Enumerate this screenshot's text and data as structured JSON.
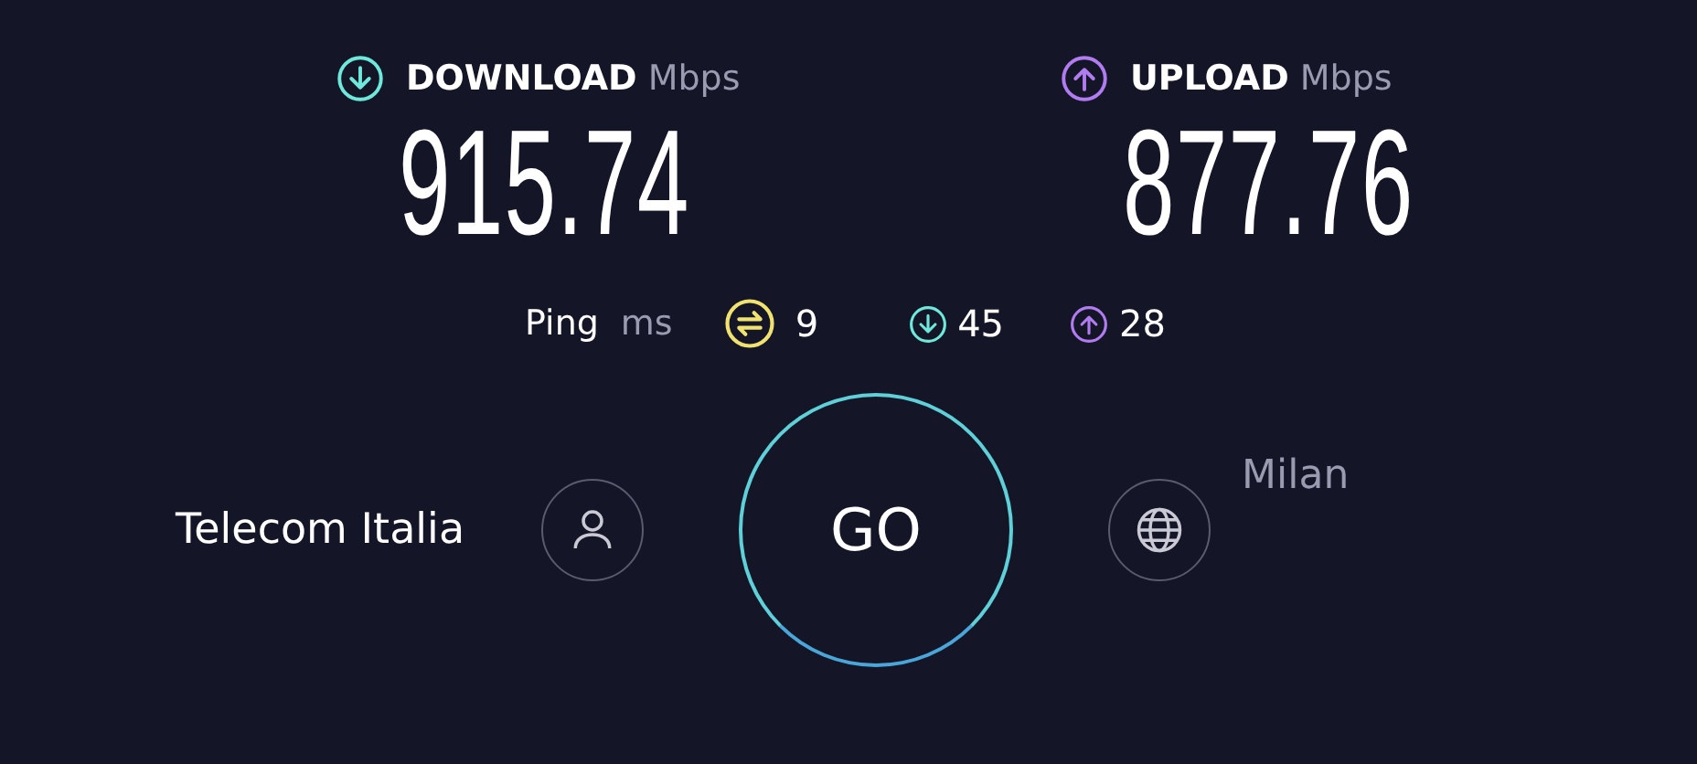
{
  "metrics": [
    {
      "kind": "download",
      "label": "DOWNLOAD",
      "unit": "Mbps",
      "value": "915.74",
      "color": "#6fe8dc"
    },
    {
      "kind": "upload",
      "label": "UPLOAD",
      "unit": "Mbps",
      "value": "877.76",
      "color": "#b07cf0"
    }
  ],
  "ping": {
    "label": "Ping",
    "unit": "ms",
    "items": [
      {
        "kind": "idle",
        "value": "9",
        "color": "#f0e270"
      },
      {
        "kind": "download",
        "value": "45",
        "color": "#6fe8dc"
      },
      {
        "kind": "upload",
        "value": "28",
        "color": "#b07cf0"
      }
    ]
  },
  "provider": {
    "name": "Telecom Italia"
  },
  "go_button": {
    "label": "GO"
  },
  "server": {
    "location": "Milan"
  }
}
